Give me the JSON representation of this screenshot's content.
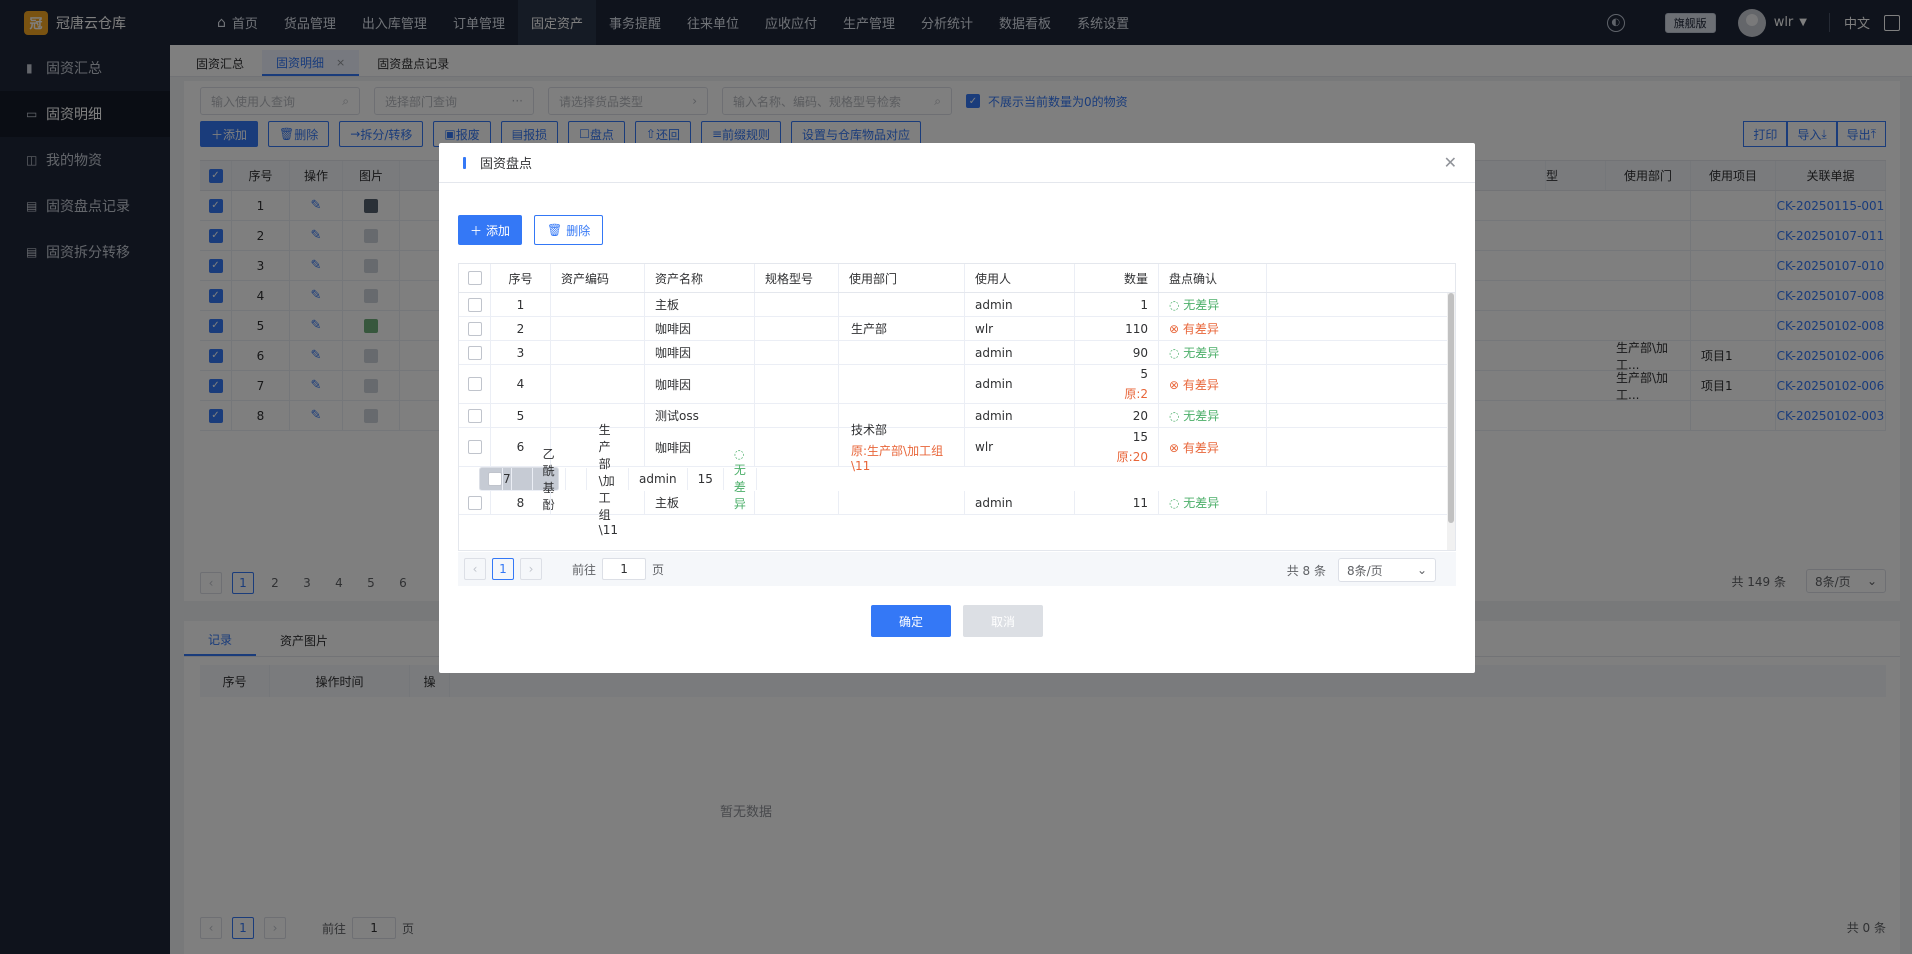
{
  "app": {
    "name": "冠唐云仓库",
    "logo_char": "冠"
  },
  "nav": [
    "首页",
    "货品管理",
    "出入库管理",
    "订单管理",
    "固定资产",
    "事务提醒",
    "往来单位",
    "应收应付",
    "生产管理",
    "分析统计",
    "数据看板",
    "系统设置"
  ],
  "topright": {
    "edition": "旗舰版",
    "user": "wlr",
    "lang": "中文"
  },
  "sidebar": [
    "固资汇总",
    "固资明细",
    "我的物资",
    "固资盘点记录",
    "固资拆分转移"
  ],
  "tabs": [
    "固资汇总",
    "固资明细",
    "固资盘点记录"
  ],
  "filters": {
    "user_ph": "输入使用人查询",
    "dept_ph": "选择部门查询",
    "type_ph": "请选择货品类型",
    "kw_ph": "输入名称、编码、规格型号检索",
    "hide_zero": "不展示当前数量为0的物资"
  },
  "actions": [
    "添加",
    "删除",
    "拆分/转移",
    "报废",
    "报损",
    "盘点",
    "还回",
    "前缀规则",
    "设置与仓库物品对应"
  ],
  "right_actions": [
    "打印",
    "导入",
    "导出"
  ],
  "bg_table": {
    "head_left": [
      "序号",
      "操作",
      "图片"
    ],
    "head_right": [
      "型",
      "使用部门",
      "使用项目",
      "关联单据"
    ],
    "rows": [
      {
        "no": "1",
        "dept": "",
        "proj": "",
        "doc": "CK-20250115-001"
      },
      {
        "no": "2",
        "dept": "",
        "proj": "",
        "doc": "CK-20250107-011"
      },
      {
        "no": "3",
        "dept": "",
        "proj": "",
        "doc": "CK-20250107-010"
      },
      {
        "no": "4",
        "dept": "",
        "proj": "",
        "doc": "CK-20250107-008"
      },
      {
        "no": "5",
        "dept": "",
        "proj": "",
        "doc": "CK-20250102-008"
      },
      {
        "no": "6",
        "dept": "生产部\\加工...",
        "proj": "项目1",
        "doc": "CK-20250102-006"
      },
      {
        "no": "7",
        "dept": "生产部\\加工...",
        "proj": "项目1",
        "doc": "CK-20250102-006"
      },
      {
        "no": "8",
        "dept": "",
        "proj": "",
        "doc": "CK-20250102-003"
      }
    ],
    "pages": [
      "1",
      "2",
      "3",
      "4",
      "5",
      "6"
    ],
    "total": "共 149 条",
    "page_size": "8条/页"
  },
  "bottom": {
    "tabs": [
      "记录",
      "资产图片"
    ],
    "head": [
      "序号",
      "操作时间",
      "操"
    ],
    "empty": "暂无数据",
    "goto_pre": "前往",
    "goto_page": "1",
    "goto_post": "页",
    "cur_page": "1",
    "total": "共 0 条"
  },
  "modal": {
    "title": "固资盘点",
    "add": "添加",
    "delete": "删除",
    "headers": [
      "序号",
      "资产编码",
      "资产名称",
      "规格型号",
      "使用部门",
      "使用人",
      "数量",
      "盘点确认"
    ],
    "rows": [
      {
        "no": "1",
        "code": "",
        "name": "主板",
        "spec": "",
        "dept": "",
        "dept_orig": "",
        "user": "admin",
        "qty": "1",
        "qty_orig": "",
        "status": "无差异",
        "ok": true
      },
      {
        "no": "2",
        "code": "",
        "name": "咖啡因",
        "spec": "",
        "dept": "生产部",
        "dept_orig": "",
        "user": "wlr",
        "qty": "110",
        "qty_orig": "",
        "status": "有差异",
        "ok": false
      },
      {
        "no": "3",
        "code": "",
        "name": "咖啡因",
        "spec": "",
        "dept": "",
        "dept_orig": "",
        "user": "admin",
        "qty": "90",
        "qty_orig": "",
        "status": "无差异",
        "ok": true
      },
      {
        "no": "4",
        "code": "",
        "name": "咖啡因",
        "spec": "",
        "dept": "",
        "dept_orig": "",
        "user": "admin",
        "qty": "5",
        "qty_orig": "原:2",
        "status": "有差异",
        "ok": false
      },
      {
        "no": "5",
        "code": "",
        "name": "测试oss",
        "spec": "",
        "dept": "",
        "dept_orig": "",
        "user": "admin",
        "qty": "20",
        "qty_orig": "",
        "status": "无差异",
        "ok": true
      },
      {
        "no": "6",
        "code": "",
        "name": "咖啡因",
        "spec": "",
        "dept": "技术部",
        "dept_orig": "原:生产部\\加工组\\11",
        "user": "wlr",
        "qty": "15",
        "qty_orig": "原:20",
        "status": "有差异",
        "ok": false
      },
      {
        "no": "7",
        "code": "",
        "name": "乙酰基酚",
        "spec": "",
        "dept": "生产部\\加工组\\11",
        "dept_orig": "",
        "user": "admin",
        "qty": "15",
        "qty_orig": "",
        "status": "无差异",
        "ok": true
      },
      {
        "no": "8",
        "code": "",
        "name": "主板",
        "spec": "",
        "dept": "",
        "dept_orig": "",
        "user": "admin",
        "qty": "11",
        "qty_orig": "",
        "status": "无差异",
        "ok": true
      }
    ],
    "pager": {
      "cur": "1",
      "goto_pre": "前往",
      "goto_page": "1",
      "goto_post": "页",
      "total": "共 8 条",
      "page_size": "8条/页"
    },
    "ok": "确定",
    "cancel": "取消"
  },
  "colors": {
    "primary": "#3478f6",
    "ok": "#4caf6a",
    "diff": "#e8663a",
    "sidebar": "#1e2738"
  }
}
